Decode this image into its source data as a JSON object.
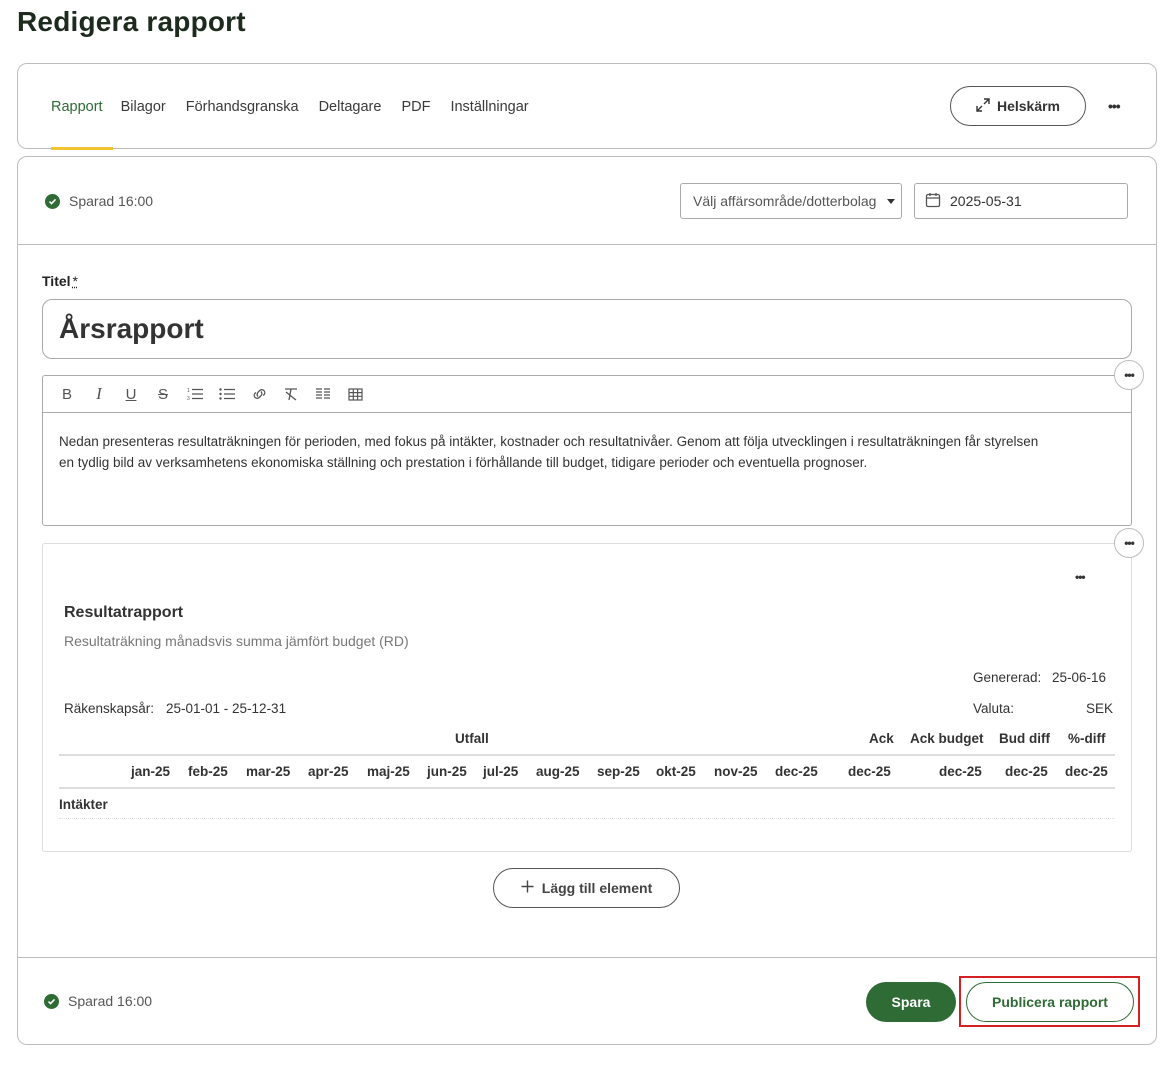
{
  "page": {
    "title": "Redigera rapport"
  },
  "tabs": [
    {
      "label": "Rapport",
      "active": true
    },
    {
      "label": "Bilagor"
    },
    {
      "label": "Förhandsgranska"
    },
    {
      "label": "Deltagare"
    },
    {
      "label": "PDF"
    },
    {
      "label": "Inställningar"
    }
  ],
  "header": {
    "fullscreen_label": "Helskärm",
    "more_label": "•••"
  },
  "status": {
    "saved_label": "Sparad 16:00"
  },
  "filters": {
    "business_area_placeholder": "Välj affärsområde/dotterbolag",
    "date_value": "2025-05-31"
  },
  "title_field": {
    "label": "Titel",
    "required_mark": "*",
    "value": "Årsrapport"
  },
  "editor": {
    "toolbar": [
      "bold-icon",
      "italic-icon",
      "underline-icon",
      "strikethrough-icon",
      "ordered-list-icon",
      "bullet-list-icon",
      "link-icon",
      "clear-format-icon",
      "columns-icon",
      "table-icon"
    ],
    "text_line1": "Nedan presenteras resultaträkningen för perioden, med fokus på intäkter, kostnader och resultatnivåer. Genom att följa utvecklingen i resultaträkningen får styrelsen",
    "text_line2": "en tydlig bild av verksamhetens ekonomiska ställning och prestation i förhållande till budget, tidigare perioder och eventuella prognoser."
  },
  "report": {
    "title": "Resultatrapport",
    "subtitle": "Resultaträkning månadsvis summa jämfört budget (RD)",
    "generated_label": "Genererad:",
    "generated_value": "25-06-16",
    "fiscal_year_label": "Räkenskapsår:",
    "fiscal_year_value": "25-01-01 - 25-12-31",
    "currency_label": "Valuta:",
    "currency_value": "SEK",
    "group_headers": {
      "outcome": "Utfall",
      "ack": "Ack",
      "ack_budget": "Ack budget",
      "bud_diff": "Bud diff",
      "pct_diff": "%-diff"
    },
    "months": [
      "jan-25",
      "feb-25",
      "mar-25",
      "apr-25",
      "maj-25",
      "jun-25",
      "jul-25",
      "aug-25",
      "sep-25",
      "okt-25",
      "nov-25",
      "dec-25"
    ],
    "summary_columns": [
      "dec-25",
      "dec-25",
      "dec-25",
      "dec-25"
    ],
    "row_label": "Intäkter"
  },
  "actions": {
    "add_element_label": "Lägg till element",
    "save_label": "Spara",
    "publish_label": "Publicera rapport"
  },
  "colors": {
    "primary": "#2f6b35",
    "tab_indicator": "#f1c232",
    "highlight": "#d42020"
  }
}
